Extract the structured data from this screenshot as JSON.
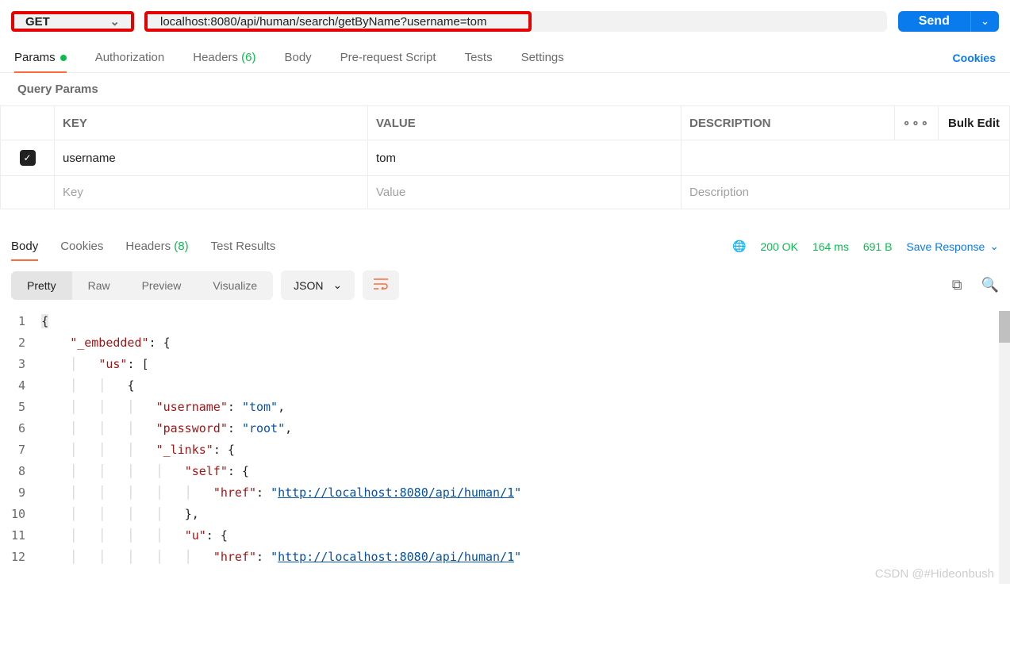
{
  "request": {
    "method": "GET",
    "url": "localhost:8080/api/human/search/getByName?username=tom",
    "send_label": "Send"
  },
  "request_tabs": {
    "params": "Params",
    "authorization": "Authorization",
    "headers_label": "Headers ",
    "headers_count": "(6)",
    "body": "Body",
    "prerequest": "Pre-request Script",
    "tests": "Tests",
    "settings": "Settings",
    "cookies": "Cookies"
  },
  "query_params": {
    "heading": "Query Params",
    "columns": {
      "key": "KEY",
      "value": "VALUE",
      "description": "DESCRIPTION",
      "bulk_edit": "Bulk Edit"
    },
    "rows": [
      {
        "checked": true,
        "key": "username",
        "value": "tom",
        "description": ""
      }
    ],
    "placeholder_row": {
      "key": "Key",
      "value": "Value",
      "description": "Description"
    }
  },
  "response_tabs": {
    "body": "Body",
    "cookies": "Cookies",
    "headers_label": "Headers ",
    "headers_count": "(8)",
    "test_results": "Test Results"
  },
  "response_meta": {
    "status": "200 OK",
    "time": "164 ms",
    "size": "691 B",
    "save_response": "Save Response"
  },
  "view_tabs": {
    "pretty": "Pretty",
    "raw": "Raw",
    "preview": "Preview",
    "visualize": "Visualize",
    "format": "JSON"
  },
  "code": {
    "l1": "{",
    "l2_k": "\"_embedded\"",
    "l2_p": ": {",
    "l3_k": "\"us\"",
    "l3_p": ": [",
    "l4": "{",
    "l5_k": "\"username\"",
    "l5_v": "\"tom\"",
    "l6_k": "\"password\"",
    "l6_v": "\"root\"",
    "l7_k": "\"_links\"",
    "l7_p": ": {",
    "l8_k": "\"self\"",
    "l8_p": ": {",
    "l9_k": "\"href\"",
    "l9_v": "http://localhost:8080/api/human/1",
    "l10": "},",
    "l11_k": "\"u\"",
    "l11_p": ": {",
    "l12_k": "\"href\"",
    "l12_v": "http://localhost:8080/api/human/1"
  },
  "watermark": "CSDN @#Hideonbush"
}
